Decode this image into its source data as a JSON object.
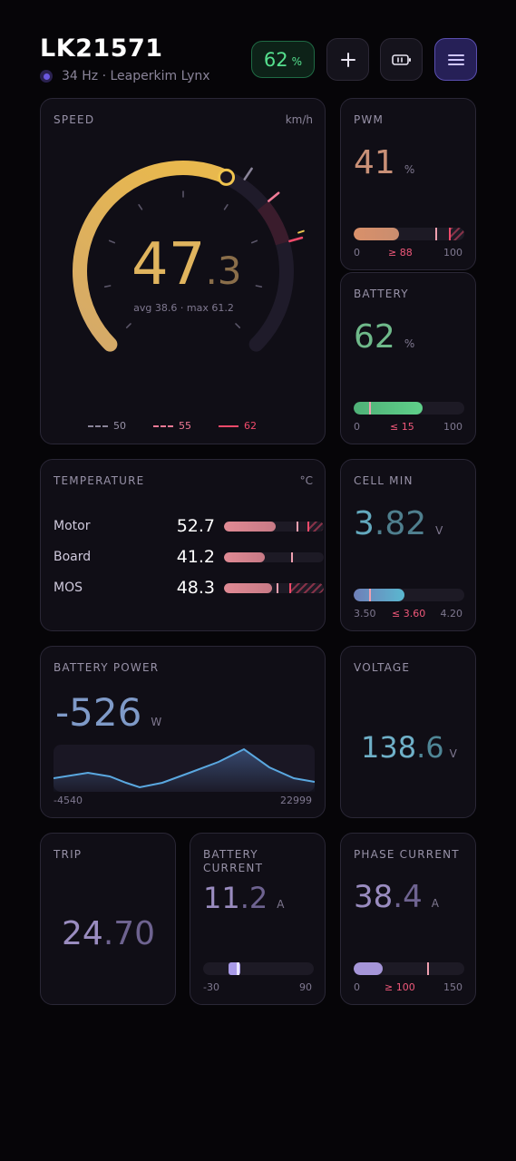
{
  "header": {
    "title": "LK21571",
    "subtitle": "34 Hz · Leaperkim Lynx",
    "battery_pill_value": "62",
    "battery_pill_unit": "%"
  },
  "speed": {
    "label": "SPEED",
    "unit": "km/h",
    "value_int": "47",
    "value_dec": ".3",
    "value": 47.3,
    "stats": "avg 38.6 · max 61.2",
    "max_scale": 80,
    "legend": [
      "50",
      "55",
      "62"
    ],
    "legend_colors": [
      "#8a8499",
      "#f07a96",
      "#f04a6a"
    ],
    "accent": "#e0b45e"
  },
  "pwm": {
    "label": "PWM",
    "value": "41",
    "unit": "%",
    "scale_min": "0",
    "scale_threshold": "≥ 88",
    "scale_max": "100",
    "fill_pct": 41,
    "warn_pct": 88
  },
  "battery": {
    "label": "BATTERY",
    "value": "62",
    "unit": "%",
    "scale_min": "0",
    "scale_threshold": "≤ 15",
    "scale_max": "100",
    "fill_pct": 62,
    "warn_pct": 15
  },
  "temperature": {
    "label": "TEMPERATURE",
    "unit": "°C",
    "rows": [
      {
        "name": "Motor",
        "value": "52.7",
        "fill_pct": 52
      },
      {
        "name": "Board",
        "value": "41.2",
        "fill_pct": 41
      },
      {
        "name": "MOS",
        "value": "48.3",
        "fill_pct": 48
      }
    ]
  },
  "cell_min": {
    "label": "CELL MIN",
    "value_int": "3",
    "value_dec": ".82",
    "unit": "V",
    "scale_min": "3.50",
    "scale_threshold": "≤ 3.60",
    "scale_max": "4.20",
    "fill_pct": 46,
    "warn_pct": 14
  },
  "battery_power": {
    "label": "BATTERY POWER",
    "value": "-526",
    "unit": "W",
    "scale_min": "-4540",
    "scale_max": "22999"
  },
  "voltage": {
    "label": "VOLTAGE",
    "value_int": "138",
    "value_dec": ".6",
    "unit": "V"
  },
  "trip": {
    "label": "TRIP",
    "value_int": "24",
    "value_dec": ".70"
  },
  "battery_current": {
    "label_line1": "BATTERY",
    "label_line2": "CURRENT",
    "value_int": "11",
    "value_dec": ".2",
    "unit": "A",
    "scale_min": "-30",
    "scale_max": "90",
    "marker_pct": 34
  },
  "phase_current": {
    "label": "PHASE CURRENT",
    "value_int": "38",
    "value_dec": ".4",
    "unit": "A",
    "scale_min": "0",
    "scale_threshold": "≥ 100",
    "scale_max": "150",
    "fill_pct": 26,
    "warn_pct": 67
  }
}
